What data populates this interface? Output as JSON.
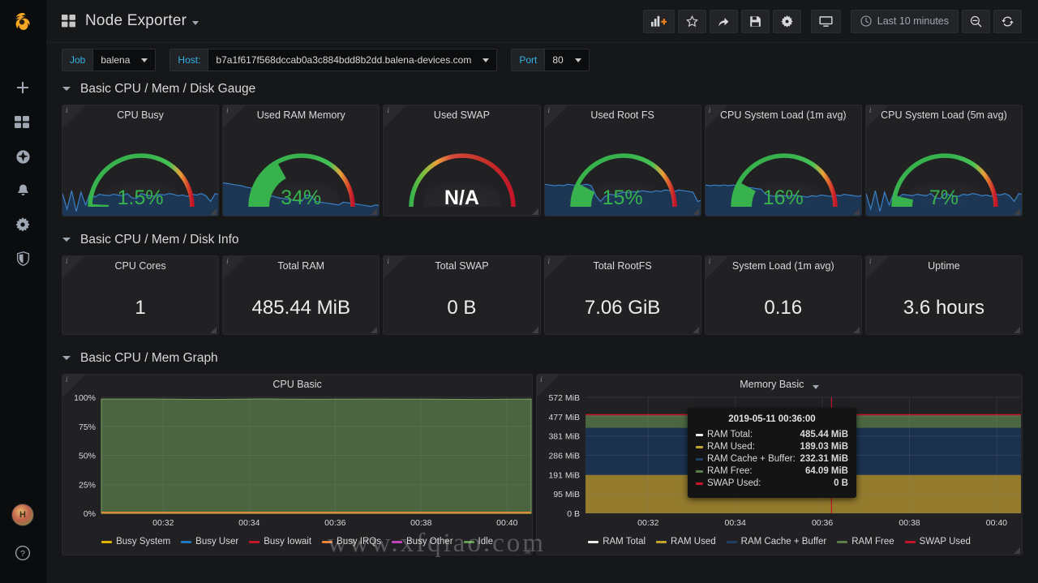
{
  "sidebar": {
    "logo_name": "grafana-logo",
    "items": [
      {
        "name": "create-add",
        "icon": "plus-icon"
      },
      {
        "name": "dashboards",
        "icon": "dashboards-icon"
      },
      {
        "name": "explore",
        "icon": "compass-icon"
      },
      {
        "name": "alerting",
        "icon": "bell-icon"
      },
      {
        "name": "configuration",
        "icon": "gear-icon"
      },
      {
        "name": "server-admin",
        "icon": "shield-icon"
      }
    ],
    "avatar_initial": "H",
    "help_label": "?"
  },
  "topnav": {
    "dashboard_title": "Node Exporter",
    "buttons": [
      {
        "name": "add-panel-button",
        "icon": "add-panel-icon",
        "label": ""
      },
      {
        "name": "star-button",
        "icon": "star-icon",
        "label": ""
      },
      {
        "name": "share-button",
        "icon": "share-icon",
        "label": ""
      },
      {
        "name": "save-button",
        "icon": "save-icon",
        "label": ""
      },
      {
        "name": "settings-button",
        "icon": "gear-icon",
        "label": ""
      },
      {
        "name": "kiosk-button",
        "icon": "monitor-icon",
        "label": ""
      }
    ],
    "time_range": "Last 10 minutes",
    "zoom_out_label": "zoom-out-icon",
    "refresh_label": "refresh-icon"
  },
  "submenu": {
    "variables": [
      {
        "label": "Job",
        "value": "balena"
      },
      {
        "label": "Host:",
        "value": "b7a1f617f568dccab0a3c884bdd8b2dd.balena-devices.com"
      },
      {
        "label": "Port",
        "value": "80"
      }
    ]
  },
  "rows": [
    {
      "title": "Basic CPU / Mem / Disk Gauge"
    },
    {
      "title": "Basic CPU / Mem / Disk Info"
    },
    {
      "title": "Basic CPU / Mem Graph"
    }
  ],
  "gauges": [
    {
      "title": "CPU Busy",
      "value": "1.5%",
      "percent": 1.5,
      "color": "#37B24D",
      "na": false
    },
    {
      "title": "Used RAM Memory",
      "value": "34%",
      "percent": 34,
      "color": "#37B24D",
      "na": false
    },
    {
      "title": "Used SWAP",
      "value": "N/A",
      "percent": 0,
      "color": "#ffffff",
      "na": true
    },
    {
      "title": "Used Root FS",
      "value": "15%",
      "percent": 15,
      "color": "#37B24D",
      "na": false
    },
    {
      "title": "CPU System Load (1m avg)",
      "value": "16%",
      "percent": 16,
      "color": "#37B24D",
      "na": false
    },
    {
      "title": "CPU System Load (5m avg)",
      "value": "7%",
      "percent": 7,
      "color": "#37B24D",
      "na": false
    }
  ],
  "stats": [
    {
      "title": "CPU Cores",
      "value": "1"
    },
    {
      "title": "Total RAM",
      "value": "485.44 MiB"
    },
    {
      "title": "Total SWAP",
      "value": "0 B"
    },
    {
      "title": "Total RootFS",
      "value": "7.06 GiB"
    },
    {
      "title": "System Load (1m avg)",
      "value": "0.16"
    },
    {
      "title": "Uptime",
      "value": "3.6 hours"
    }
  ],
  "chart_data": [
    {
      "type": "area",
      "panel_title": "CPU Basic",
      "title": "CPU Basic",
      "xlabel": "",
      "ylabel": "",
      "ylim": [
        0,
        100
      ],
      "yticks": [
        "0%",
        "25%",
        "50%",
        "75%",
        "100%"
      ],
      "xticks": [
        "00:32",
        "00:34",
        "00:36",
        "00:38",
        "00:40"
      ],
      "grid": true,
      "legend_position": "bottom",
      "stacked": true,
      "series": [
        {
          "name": "Busy System",
          "color": "#E0B400",
          "values": [
            0.6,
            0.6,
            0.6,
            0.6,
            0.6,
            0.6,
            0.6,
            0.6,
            0.6
          ]
        },
        {
          "name": "Busy User",
          "color": "#1F78C1",
          "values": [
            0.5,
            0.5,
            0.5,
            0.5,
            0.5,
            0.5,
            0.5,
            0.5,
            0.5
          ]
        },
        {
          "name": "Busy Iowait",
          "color": "#C4162A",
          "values": [
            0.1,
            0.1,
            0.1,
            0.1,
            0.1,
            0.1,
            0.1,
            0.1,
            0.1
          ]
        },
        {
          "name": "Busy IRQs",
          "color": "#E8833A",
          "values": [
            0.2,
            0.2,
            0.2,
            0.2,
            0.2,
            0.2,
            0.2,
            0.2,
            0.2
          ]
        },
        {
          "name": "Busy Other",
          "color": "#C145B8",
          "values": [
            0.1,
            0.1,
            0.1,
            0.1,
            0.1,
            0.1,
            0.1,
            0.1,
            0.1
          ]
        },
        {
          "name": "Idle",
          "color": "#629E51",
          "values": [
            98.5,
            98.5,
            98.2,
            98.6,
            98.3,
            98.5,
            98.4,
            98.2,
            98.5
          ]
        }
      ]
    },
    {
      "type": "area",
      "panel_title": "Memory Basic",
      "title": "Memory Basic",
      "xlabel": "",
      "ylabel": "",
      "ylim": [
        0,
        572
      ],
      "yticks": [
        "0 B",
        "95 MiB",
        "191 MiB",
        "286 MiB",
        "381 MiB",
        "477 MiB",
        "572 MiB"
      ],
      "xticks": [
        "00:32",
        "00:34",
        "00:36",
        "00:38",
        "00:40"
      ],
      "grid": true,
      "legend_position": "bottom",
      "stacked": true,
      "series": [
        {
          "name": "RAM Total",
          "color": "#ededed",
          "values": [
            485.44,
            485.44,
            485.44,
            485.44,
            485.44,
            485.44,
            485.44,
            485.44,
            485.44
          ]
        },
        {
          "name": "RAM Used",
          "color": "#C0A22C",
          "values": [
            189.03,
            189.03,
            189.03,
            189.03,
            189.03,
            189.03,
            189.03,
            189.03,
            189.03
          ]
        },
        {
          "name": "RAM Cache + Buffer",
          "color": "#1F3E63",
          "values": [
            232.31,
            232.31,
            232.31,
            232.31,
            232.31,
            232.31,
            232.31,
            232.31,
            232.31
          ]
        },
        {
          "name": "RAM Free",
          "color": "#5B7E4A",
          "values": [
            64.09,
            64.09,
            64.09,
            64.09,
            64.09,
            64.09,
            64.09,
            64.09,
            64.09
          ]
        },
        {
          "name": "SWAP Used",
          "color": "#C4162A",
          "values": [
            0,
            0,
            0,
            0,
            0,
            0,
            0,
            0,
            0
          ]
        }
      ]
    }
  ],
  "tooltip": {
    "time": "2019-05-11 00:36:00",
    "rows": [
      {
        "label": "RAM Total:",
        "value": "485.44 MiB",
        "color": "#ededed"
      },
      {
        "label": "RAM Used:",
        "value": "189.03 MiB",
        "color": "#C0A22C"
      },
      {
        "label": "RAM Cache + Buffer:",
        "value": "232.31 MiB",
        "color": "#1F3E63"
      },
      {
        "label": "RAM Free:",
        "value": "64.09 MiB",
        "color": "#5B7E4A"
      },
      {
        "label": "SWAP Used:",
        "value": "0 B",
        "color": "#C4162A"
      }
    ]
  },
  "watermark": "www.xfqiao.com"
}
